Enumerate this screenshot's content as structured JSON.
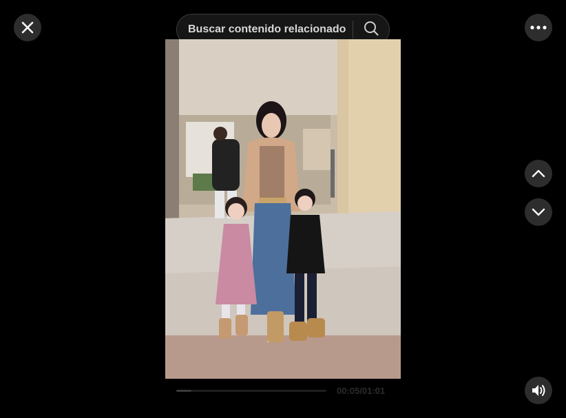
{
  "search": {
    "placeholder": "Buscar contenido relacionado"
  },
  "controls": {
    "close_icon": "close-icon",
    "more_icon": "more-icon",
    "prev_icon": "chevron-up-icon",
    "next_icon": "chevron-down-icon",
    "volume_icon": "volume-icon",
    "search_icon": "search-icon"
  },
  "player": {
    "time": "00:05/01:01",
    "progress_fraction": 0.1
  },
  "colors": {
    "background": "#000000",
    "button_bg": "#2d2d2d",
    "search_bg": "#161616"
  }
}
